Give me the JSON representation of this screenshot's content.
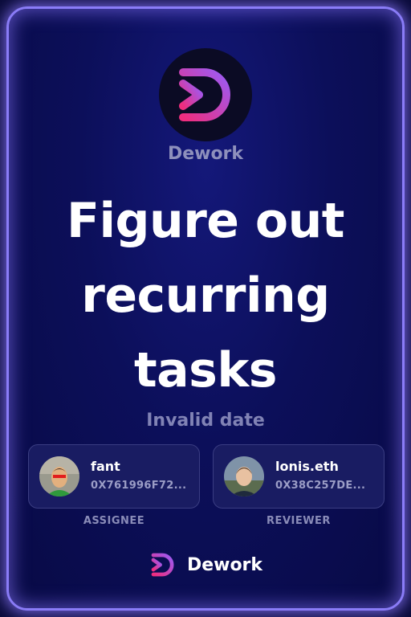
{
  "brand": {
    "name": "Dework",
    "footer_name": "Dework"
  },
  "task": {
    "title": "Figure out recurring tasks",
    "date": "Invalid date"
  },
  "assignee": {
    "name": "fant",
    "address": "0X761996F72...",
    "role": "ASSIGNEE"
  },
  "reviewer": {
    "name": "lonis.eth",
    "address": "0X38C257DE...",
    "role": "REVIEWER"
  },
  "colors": {
    "accent_pink": "#e0338e",
    "accent_purple": "#8a5cf5",
    "border_glow": "#8a7cf7",
    "background": "#0a0b3a"
  }
}
